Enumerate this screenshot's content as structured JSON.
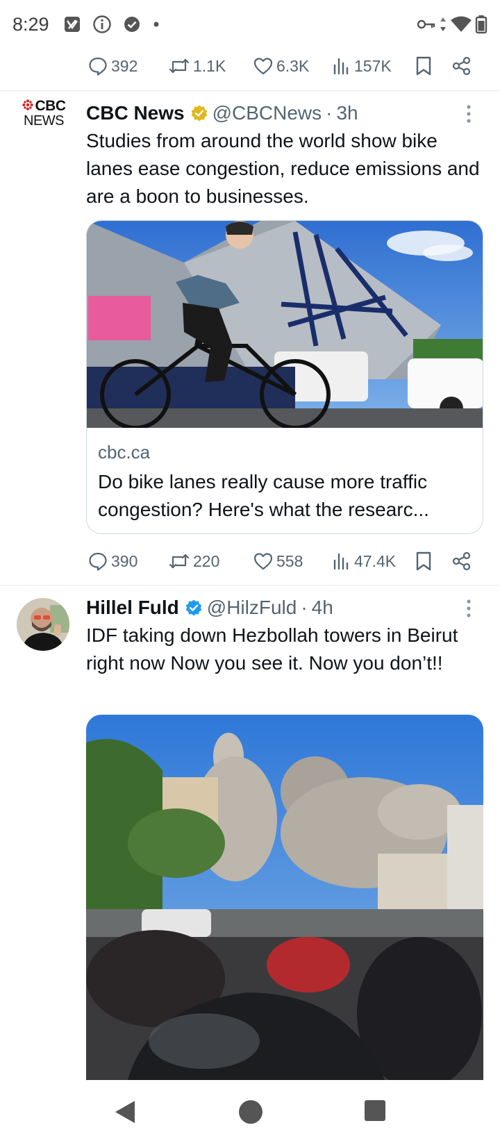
{
  "status_bar": {
    "time": "8:29",
    "left_icons": [
      "notification-icon",
      "info-icon",
      "check-circle-icon",
      "dot-icon"
    ],
    "right_icons": [
      "vpn-key-icon",
      "data-arrows-icon",
      "wifi-icon",
      "battery-icon"
    ]
  },
  "prev_tweet_actions": {
    "replies": "392",
    "reposts": "1.1K",
    "likes": "6.3K",
    "views": "157K"
  },
  "tweets": [
    {
      "author": "CBC News",
      "verified": "gold",
      "handle": "@CBCNews",
      "separator": "·",
      "time": "3h",
      "avatar_text_top": "CBC",
      "avatar_text_bottom": "NEWS",
      "text": "Studies from around the world show bike lanes ease congestion, reduce emissions and are a boon to businesses.",
      "card": {
        "domain": "cbc.ca",
        "title": "Do bike lanes really cause more traffic congestion? Here's what the researc..."
      },
      "actions": {
        "replies": "390",
        "reposts": "220",
        "likes": "558",
        "views": "47.4K"
      }
    },
    {
      "author": "Hillel Fuld",
      "verified": "blue",
      "handle": "@HilzFuld",
      "separator": "·",
      "time": "4h",
      "text": "IDF taking down Hezbollah towers in Beirut right now  Now you see it. Now you don’t!!"
    }
  ],
  "nav_bar": {
    "buttons": [
      "back-icon",
      "home-icon",
      "recents-icon"
    ]
  },
  "colors": {
    "text_primary": "#0f1419",
    "text_secondary": "#536471",
    "verified_blue": "#1d9bf0",
    "verified_gold": "#e2b719",
    "cbc_red": "#d8232a"
  }
}
